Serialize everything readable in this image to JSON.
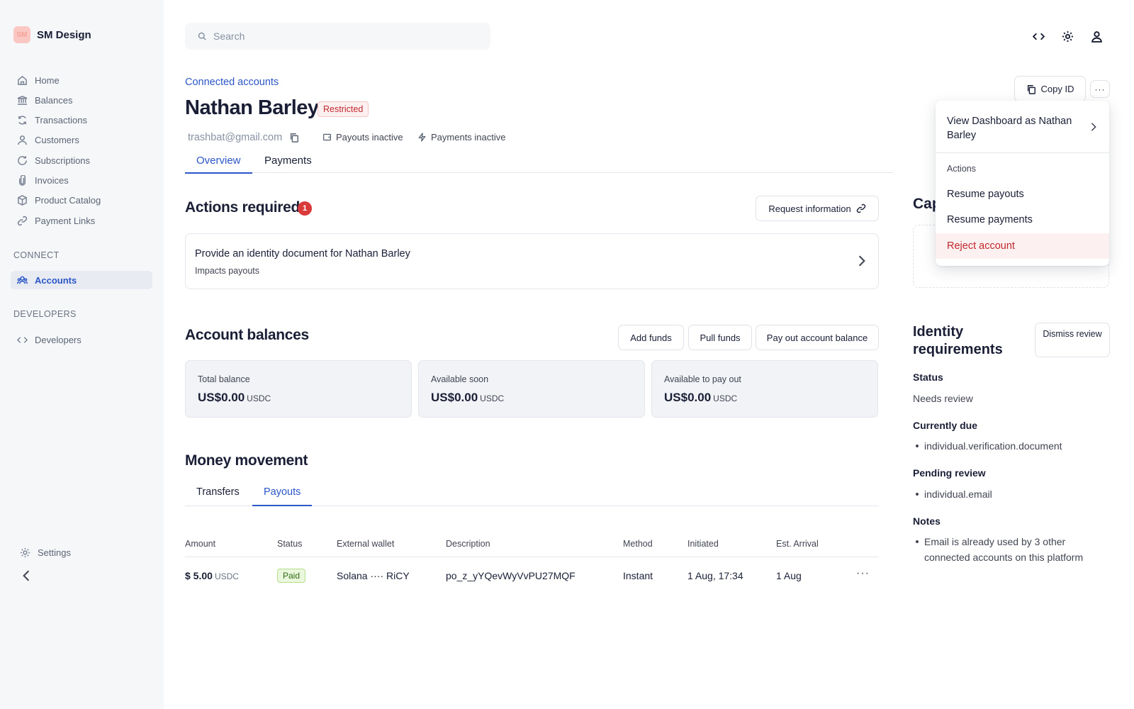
{
  "brand": {
    "logo_text": "SM",
    "name": "SM Design"
  },
  "nav": {
    "main": [
      {
        "label": "Home",
        "icon": "home-icon"
      },
      {
        "label": "Balances",
        "icon": "bank-icon"
      },
      {
        "label": "Transactions",
        "icon": "refresh-icon"
      },
      {
        "label": "Customers",
        "icon": "user-icon"
      },
      {
        "label": "Subscriptions",
        "icon": "rotate-icon"
      },
      {
        "label": "Invoices",
        "icon": "paperclip-icon"
      },
      {
        "label": "Product Catalog",
        "icon": "box-icon"
      },
      {
        "label": "Payment Links",
        "icon": "link-icon"
      }
    ],
    "connect_label": "CONNECT",
    "connect": [
      {
        "label": "Accounts",
        "icon": "users-icon",
        "active": true
      }
    ],
    "developers_label": "DEVELOPERS",
    "developers": [
      {
        "label": "Developers",
        "icon": "code-icon"
      }
    ],
    "settings": "Settings"
  },
  "search": {
    "placeholder": "Search"
  },
  "header": {
    "breadcrumb": "Connected accounts",
    "title": "Nathan Barley",
    "status_badge": "Restricted",
    "email": "trashbat@gmail.com",
    "payouts_status": "Payouts inactive",
    "payments_status": "Payments inactive",
    "copy_id": "Copy ID",
    "more": "···"
  },
  "tabs": [
    "Overview",
    "Payments"
  ],
  "actions_required": {
    "title": "Actions required",
    "count": "1",
    "request_button": "Request information",
    "card_title": "Provide an identity document for Nathan Barley",
    "card_subtitle": "Impacts payouts"
  },
  "balances": {
    "title": "Account balances",
    "buttons": [
      "Add funds",
      "Pull funds",
      "Pay out account balance"
    ],
    "cards": [
      {
        "label": "Total balance",
        "value": "US$0.00",
        "unit": "USDC"
      },
      {
        "label": "Available soon",
        "value": "US$0.00",
        "unit": "USDC"
      },
      {
        "label": "Available to pay out",
        "value": "US$0.00",
        "unit": "USDC"
      }
    ]
  },
  "money_movement": {
    "title": "Money movement",
    "tabs": [
      "Transfers",
      "Payouts"
    ],
    "columns": [
      "Amount",
      "Status",
      "External wallet",
      "Description",
      "Method",
      "Initiated",
      "Est. Arrival"
    ],
    "rows": [
      {
        "amount": "$ 5.00",
        "unit": "USDC",
        "status": "Paid",
        "wallet": "Solana ···· RiCY",
        "description": "po_z_yYQevWyVvPU27MQF",
        "method": "Instant",
        "initiated": "1 Aug, 17:34",
        "arrival": "1 Aug",
        "more": "···"
      }
    ]
  },
  "right_panel": {
    "cap_title": "Cap",
    "identity_title": "Identity requirements",
    "dismiss": "Dismiss review",
    "status_label": "Status",
    "status_value": "Needs review",
    "due_label": "Currently due",
    "due_items": [
      "individual.verification.document"
    ],
    "pending_label": "Pending review",
    "pending_items": [
      "individual.email"
    ],
    "notes_label": "Notes",
    "notes_items": [
      "Email is already used by 3 other connected accounts on this platform"
    ]
  },
  "dropdown": {
    "view_dashboard": "View Dashboard as Nathan Barley",
    "actions_label": "Actions",
    "items": [
      "Resume payouts",
      "Resume payments",
      "Reject account"
    ]
  },
  "colors": {
    "accent": "#2b56c7",
    "danger": "#c0282d",
    "sidebar_bg": "#f6f7f9"
  }
}
